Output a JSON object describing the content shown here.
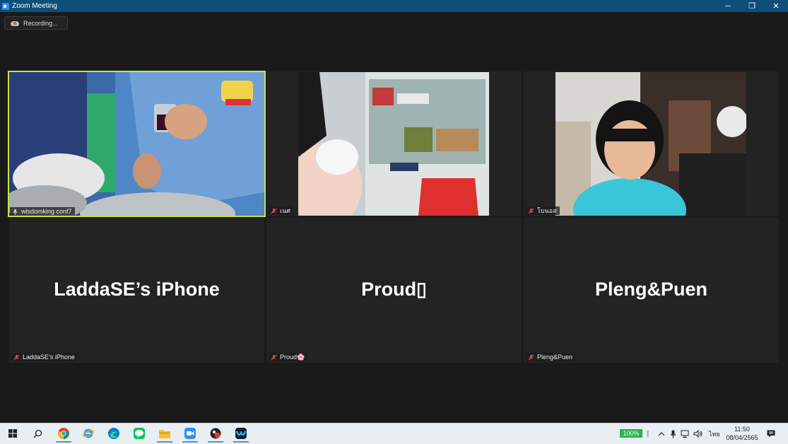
{
  "window": {
    "title": "Zoom Meeting",
    "minimize": "─",
    "restore": "❐",
    "close": "✕"
  },
  "recording": {
    "label": "Recording..."
  },
  "participants": [
    {
      "name": "wisdomking conf7",
      "muted": false
    },
    {
      "name": "เนศ",
      "muted": true
    },
    {
      "name": "โบนอส",
      "muted": true
    },
    {
      "name": "LaddaSE’s iPhone",
      "display": "LaddaSE’s iPhone",
      "muted": true
    },
    {
      "name": "Proud🌸",
      "display": "Proud▯",
      "muted": true
    },
    {
      "name": "Pleng&Puen",
      "display": "Pleng&Puen",
      "muted": true
    }
  ],
  "taskbar": {
    "apps": [
      "windows-start",
      "search",
      "chrome",
      "internet-explorer",
      "edge",
      "line",
      "file-explorer",
      "zoom",
      "camera-app",
      "webex"
    ],
    "battery": "100%",
    "language": "ไทย",
    "time": "11:50",
    "date": "08/04/2565"
  },
  "colors": {
    "titlebar": "#0e4f7a",
    "active_speaker": "#c9e04a",
    "tile_bg": "#232323",
    "stage_bg": "#1a1a1a"
  }
}
